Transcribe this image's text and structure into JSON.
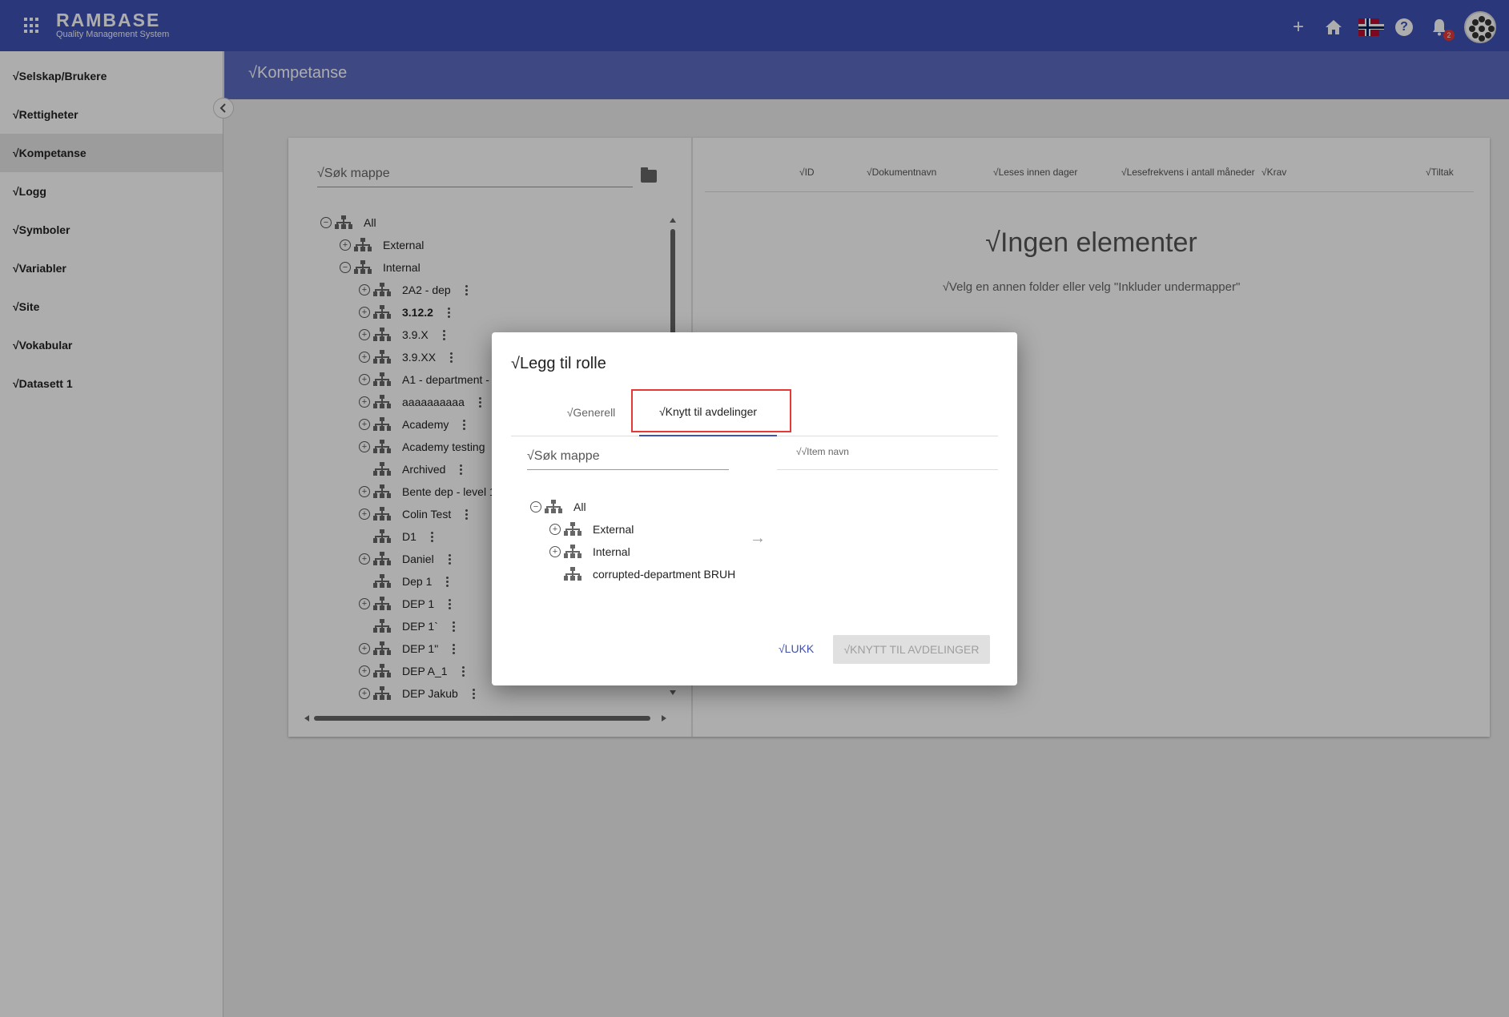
{
  "app": {
    "brand": "RAMBASE",
    "subtitle": "Quality Management System",
    "notification_count": "2"
  },
  "sidebar": {
    "items": [
      {
        "label": "√Selskap/Brukere"
      },
      {
        "label": "√Rettigheter"
      },
      {
        "label": "√Kompetanse"
      },
      {
        "label": "√Logg"
      },
      {
        "label": "√Symboler"
      },
      {
        "label": "√Variabler"
      },
      {
        "label": "√Site"
      },
      {
        "label": "√Vokabular"
      },
      {
        "label": "√Datasett 1"
      }
    ]
  },
  "page": {
    "title": "√Kompetanse"
  },
  "left_pane": {
    "search_placeholder": "√Søk mappe",
    "tree": [
      {
        "label": "All",
        "toggle": "minus",
        "menu": false
      },
      {
        "label": "External",
        "toggle": "plus",
        "menu": false
      },
      {
        "label": "Internal",
        "toggle": "minus",
        "menu": false
      },
      {
        "label": "2A2 - dep",
        "toggle": "plus",
        "menu": true
      },
      {
        "label": "3.12.2",
        "toggle": "plus",
        "menu": true,
        "bold": true
      },
      {
        "label": "3.9.X",
        "toggle": "plus",
        "menu": true
      },
      {
        "label": "3.9.XX",
        "toggle": "plus",
        "menu": true
      },
      {
        "label": "A1 - department -",
        "toggle": "plus",
        "menu": false
      },
      {
        "label": "aaaaaaaaaa",
        "toggle": "plus",
        "menu": true
      },
      {
        "label": "Academy",
        "toggle": "plus",
        "menu": true
      },
      {
        "label": "Academy testing",
        "toggle": "plus",
        "menu": false
      },
      {
        "label": "Archived",
        "toggle": "none",
        "menu": true
      },
      {
        "label": "Bente dep - level 1",
        "toggle": "plus",
        "menu": false
      },
      {
        "label": "Colin Test",
        "toggle": "plus",
        "menu": true
      },
      {
        "label": "D1",
        "toggle": "none",
        "menu": true
      },
      {
        "label": "Daniel",
        "toggle": "plus",
        "menu": true
      },
      {
        "label": "Dep 1",
        "toggle": "none",
        "menu": true
      },
      {
        "label": "DEP 1",
        "toggle": "plus",
        "menu": true
      },
      {
        "label": "DEP 1`",
        "toggle": "none",
        "menu": true
      },
      {
        "label": "DEP 1\"",
        "toggle": "plus",
        "menu": true
      },
      {
        "label": "DEP A_1",
        "toggle": "plus",
        "menu": true
      },
      {
        "label": "DEP Jakub",
        "toggle": "plus",
        "menu": true
      }
    ]
  },
  "table": {
    "headers": [
      "√ID",
      "√Dokumentnavn",
      "√Leses innen dager",
      "√Lesefrekvens i antall måneder",
      "√Krav",
      "√Tiltak"
    ],
    "empty_title": "√Ingen elementer",
    "empty_sub": "√Velg en annen folder eller velg \"Inkluder undermapper\""
  },
  "dialog": {
    "title": "√Legg til rolle",
    "tabs": [
      "√Generell",
      "√Knytt til avdelinger"
    ],
    "search_placeholder": "√Søk mappe",
    "item_header": "√√Item navn",
    "tree": [
      {
        "label": "All",
        "toggle": "minus"
      },
      {
        "label": "External",
        "toggle": "plus"
      },
      {
        "label": "Internal",
        "toggle": "plus"
      },
      {
        "label": "corrupted-department BRUH",
        "toggle": "none"
      }
    ],
    "close_label": "√LUKK",
    "submit_label": "√KNYTT TIL AVDELINGER"
  },
  "colors": {
    "primary": "#3f51b5",
    "header": "#5c6bc0",
    "highlight": "#e53935"
  }
}
